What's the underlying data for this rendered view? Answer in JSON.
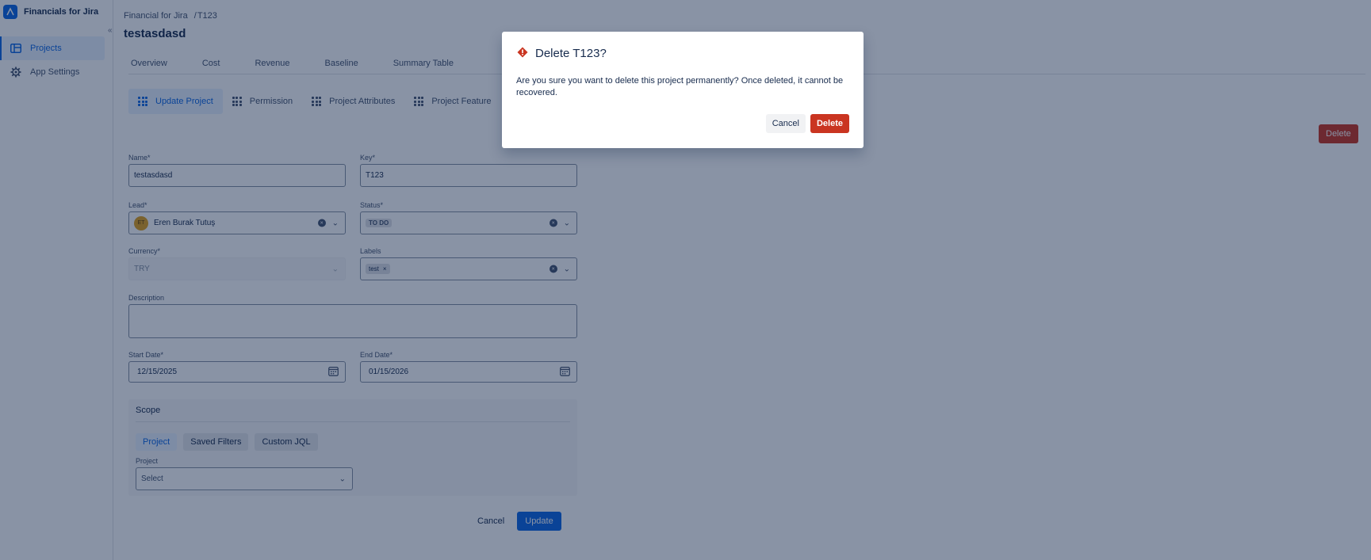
{
  "app": {
    "name": "Financials for Jira"
  },
  "sidebar": {
    "collapse": "«",
    "items": [
      {
        "label": "Projects",
        "icon": "board-icon",
        "active": true
      },
      {
        "label": "App Settings",
        "icon": "gear-icon",
        "active": false
      }
    ]
  },
  "breadcrumb": {
    "root": "Financial for Jira",
    "separator": "/",
    "current": "T123"
  },
  "page_title": "testasdasd",
  "tabs": [
    "Overview",
    "Cost",
    "Revenue",
    "Baseline",
    "Summary Table"
  ],
  "subtabs": [
    "Update Project",
    "Permission",
    "Project Attributes",
    "Project Feature"
  ],
  "top_delete_label": "Delete",
  "form": {
    "name": {
      "label": "Name*",
      "value": "testasdasd"
    },
    "key": {
      "label": "Key*",
      "value": "T123"
    },
    "lead": {
      "label": "Lead*",
      "value": "Eren Burak Tutuş",
      "initials": "ET"
    },
    "status": {
      "label": "Status*",
      "value": "TO DO"
    },
    "currency": {
      "label": "Currency*",
      "value": "TRY"
    },
    "labels": {
      "label": "Labels",
      "tag": "test",
      "tag_remove": "×"
    },
    "description": {
      "label": "Description",
      "value": ""
    },
    "start_date": {
      "label": "Start Date*",
      "value": "12/15/2025"
    },
    "end_date": {
      "label": "End Date*",
      "value": "01/15/2026"
    },
    "scope": {
      "title": "Scope",
      "buttons": [
        "Project",
        "Saved Filters",
        "Custom JQL"
      ],
      "project_label": "Project",
      "project_placeholder": "Select"
    },
    "cancel_label": "Cancel",
    "update_label": "Update"
  },
  "modal": {
    "title": "Delete T123?",
    "body": "Are you sure you want to delete this project permanently? Once deleted, it cannot be recovered.",
    "cancel_label": "Cancel",
    "delete_label": "Delete"
  },
  "colors": {
    "primary": "#0c66e4",
    "danger": "#ca3521",
    "overlay": "rgba(9,30,66,0.48)"
  }
}
